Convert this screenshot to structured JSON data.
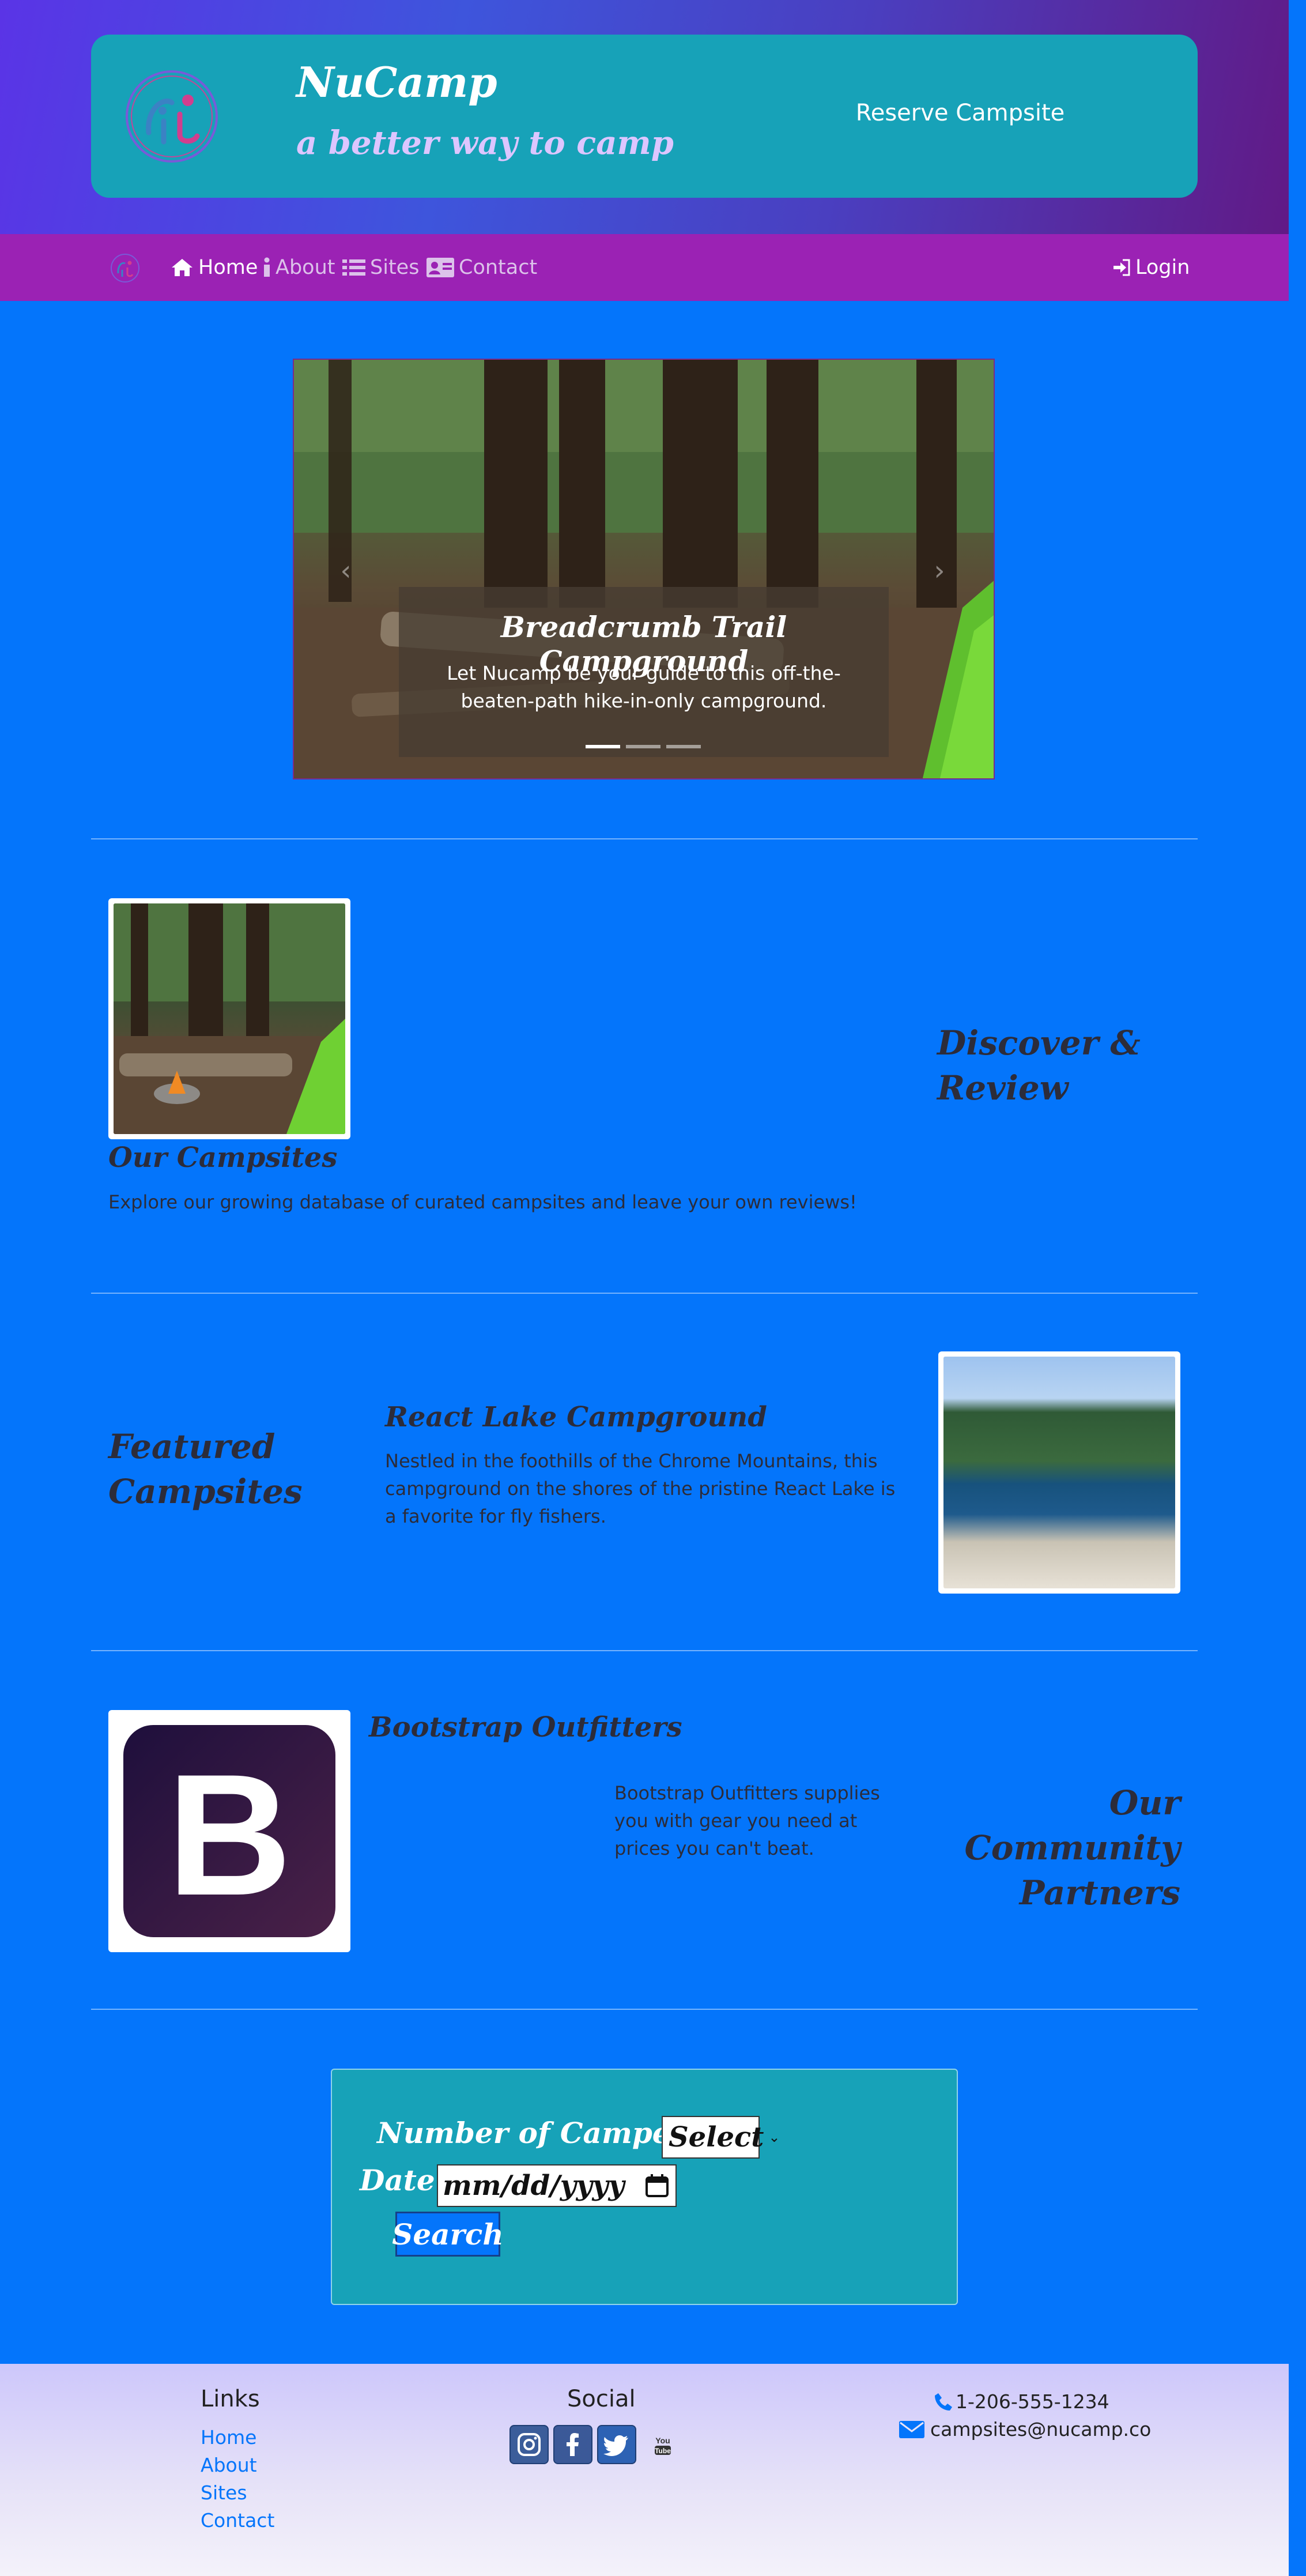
{
  "header": {
    "brand_name": "NuCamp",
    "tagline": "a better way to camp",
    "reserve_label": "Reserve Campsite"
  },
  "nav": {
    "items": [
      {
        "label": "Home",
        "active": true
      },
      {
        "label": "About"
      },
      {
        "label": "Sites"
      },
      {
        "label": "Contact"
      }
    ],
    "login_label": "Login"
  },
  "carousel": {
    "caption_title": "Breadcrumb Trail Campground",
    "caption_text": "Let Nucamp be your guide to this off-the-beaten-path hike-in-only campground.",
    "slides": 3,
    "active_slide": 1
  },
  "campsites": {
    "heading": "Our Campsites",
    "text": "Explore our growing database of curated campsites and leave your own reviews!",
    "side_heading": "Discover & Review"
  },
  "featured": {
    "side_heading": "Featured Campsites",
    "title": "React Lake Campground",
    "text": "Nestled in the foothills of the Chrome Mountains, this campground on the shores of the pristine React Lake is a favorite for fly fishers."
  },
  "partners": {
    "title": "Bootstrap Outfitters",
    "text": "Bootstrap Outfitters supplies you with gear you need at prices you can't beat.",
    "side_heading": "Our Community Partners",
    "logo_letter": "B"
  },
  "search_form": {
    "campers_label": "Number of Campers",
    "campers_value": "Select",
    "date_label": "Date",
    "date_placeholder": "mm/dd/yyyy",
    "search_label": "Search"
  },
  "footer": {
    "links_heading": "Links",
    "links": [
      "Home",
      "About",
      "Sites",
      "Contact"
    ],
    "social_heading": "Social",
    "social_icons": [
      "instagram-icon",
      "facebook-icon",
      "twitter-icon",
      "youtube-icon"
    ],
    "phone": "1-206-555-1234",
    "email": "campsites@nucamp.co"
  },
  "colors": {
    "page_bg": "#0475fb",
    "header_card": "#17a2b8",
    "nav_bg": "#9b22b4",
    "link": "#0475fb"
  }
}
